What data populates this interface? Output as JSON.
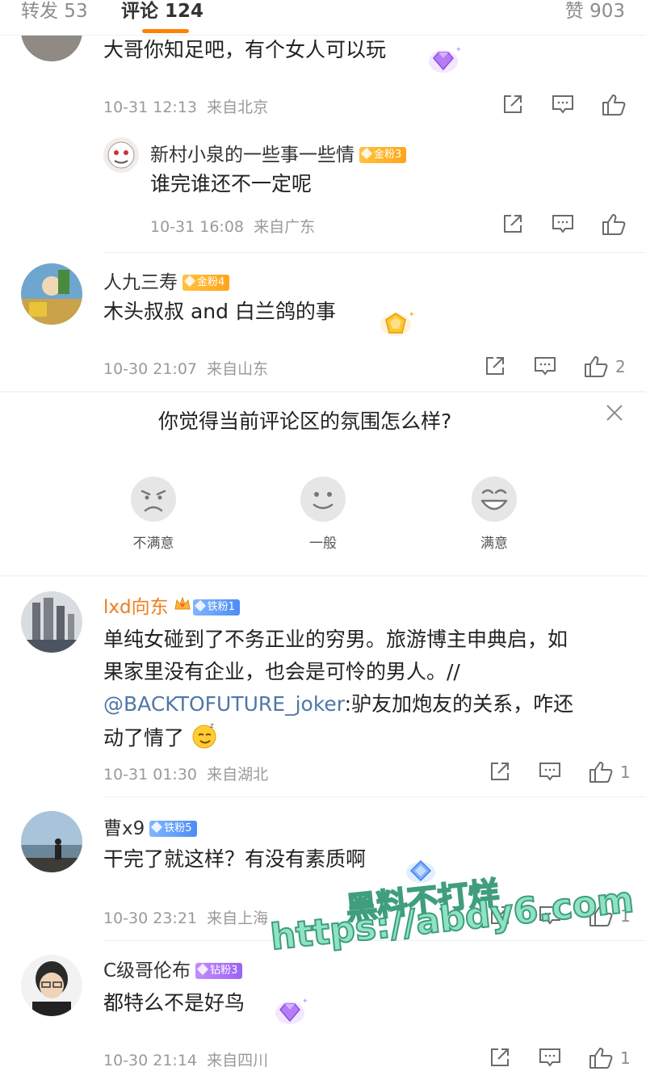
{
  "tabs": {
    "repost": "转发 53",
    "comments": "评论 124",
    "likes": "赞 903"
  },
  "comments": [
    {
      "text": "大哥你知足吧，有个女人可以玩",
      "time": "10-31 12:13",
      "location": "来自北京",
      "likes": ""
    },
    {
      "username": "新村小泉的一些事一些情",
      "badge": "金粉3",
      "text": "谁完谁还不一定呢",
      "time": "10-31 16:08",
      "location": "来自广东",
      "likes": ""
    },
    {
      "username": "人九三寿",
      "badge": "金粉4",
      "text": "木头叔叔  and  白兰鸽的事",
      "time": "10-30 21:07",
      "location": "来自山东",
      "likes": "2"
    },
    {
      "username": "lxd向东",
      "badge": "铁粉1",
      "text_line1": "单纯女碰到了不务正业的穷男。旅游博主申典启，如",
      "text_line2": "果家里没有企业，也会是可怜的男人。//",
      "mention": "@BACKTOFUTURE_joker",
      "text_line3_rest": ":驴友加炮友的关系，咋还",
      "text_line4": "动了情了",
      "time": "10-31 01:30",
      "location": "来自湖北",
      "likes": "1"
    },
    {
      "username": "曹x9",
      "badge": "铁粉5",
      "text": "干完了就这样？有没有素质啊",
      "time": "10-30 23:21",
      "location": "来自上海",
      "likes": "1"
    },
    {
      "username": "C级哥伦布",
      "badge": "钻粉3",
      "text": "都特么不是好鸟",
      "time": "10-30 21:14",
      "location": "来自四川",
      "likes": "1"
    }
  ],
  "survey": {
    "question": "你觉得当前评论区的氛围怎么样?",
    "options": [
      "不满意",
      "一般",
      "满意"
    ]
  },
  "watermark": {
    "line1": "黑料不打烊",
    "line2": "https://abdy6.com"
  },
  "colors": {
    "accent": "#ff8200",
    "mention": "#4f77a8",
    "gold_badge": "#ffb02e",
    "iron_badge": "#5b95f7",
    "diamond_badge": "#a56df7"
  }
}
